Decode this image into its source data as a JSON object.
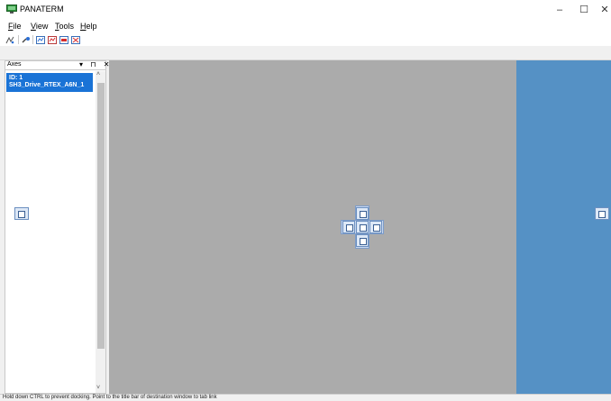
{
  "window": {
    "title": "PANATERM",
    "controls": {
      "minimize": "–",
      "maximize": "☐",
      "close": "✕"
    }
  },
  "menu": {
    "items": [
      {
        "pre": "",
        "u": "F",
        "post": "ile"
      },
      {
        "pre": "",
        "u": "V",
        "post": "iew"
      },
      {
        "pre": "",
        "u": "T",
        "post": "ools"
      },
      {
        "pre": "",
        "u": "H",
        "post": "elp"
      }
    ]
  },
  "toolbar": {
    "icons": [
      "connect-icon",
      "settings-icon",
      "monitor-icon",
      "graph-icon",
      "trace-icon",
      "diagnostics-icon"
    ]
  },
  "axes_panel": {
    "title": "Axes",
    "header_buttons": "▾ ⊓ ✕",
    "selected_item": {
      "id_line": "ID: 1",
      "name": "SH3_Drive_RTEX_A6N_1"
    },
    "scroll_up": "˄",
    "scroll_down": "˅"
  },
  "status": {
    "text": "Hold down CTRL to prevent docking. Point to the title bar of destination window to tab link"
  },
  "colors": {
    "doc_area": "#ababab",
    "dock_preview": "#5591c5",
    "selection": "#1a73d6"
  }
}
